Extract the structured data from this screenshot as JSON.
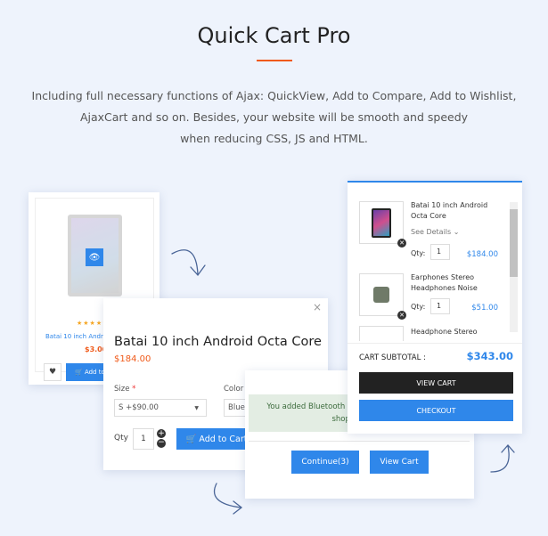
{
  "header": {
    "title": "Quick Cart Pro",
    "description": [
      "Including full necessary functions of Ajax: QuickView, Add to Compare, Add to Wishlist,",
      "AjaxCart and so on. Besides, your website will be smooth and speedy",
      "when reducing CSS, JS and HTML."
    ]
  },
  "colors": {
    "accent": "#2f87ea",
    "price": "#f05a1a",
    "dark_button": "#222222",
    "success_bg": "#e3ede3"
  },
  "product_card": {
    "name": "Batai 10 inch Android Octa Core",
    "price": "$3.00",
    "add_label": "Add to Cart",
    "rating": 5
  },
  "quickview": {
    "title": "Batai 10 inch Android Octa Core",
    "price": "$184.00",
    "size_label": "Size",
    "required": "*",
    "size_value": "S +$90.00",
    "color_label": "Color",
    "color_value": "Blue",
    "qty_label": "Qty",
    "qty_value": "1",
    "add_label": "Add to Cart"
  },
  "success": {
    "message": "You added Bluetooth Stereo Headphones to your shopping cart.",
    "continue_label": "Continue(3)",
    "view_cart_label": "View Cart"
  },
  "cart": {
    "items": [
      {
        "name": "Batai 10 inch Android Octa Core",
        "details": "See Details",
        "qty_label": "Qty:",
        "qty": "1",
        "price": "$184.00"
      },
      {
        "name": "Earphones Stereo Headphones Noise",
        "qty_label": "Qty:",
        "qty": "1",
        "price": "$51.00"
      },
      {
        "name": "Headphone Stereo"
      }
    ],
    "subtotal_label": "CART SUBTOTAL :",
    "subtotal": "$343.00",
    "view_cart": "VIEW CART",
    "checkout": "CHECKOUT"
  }
}
